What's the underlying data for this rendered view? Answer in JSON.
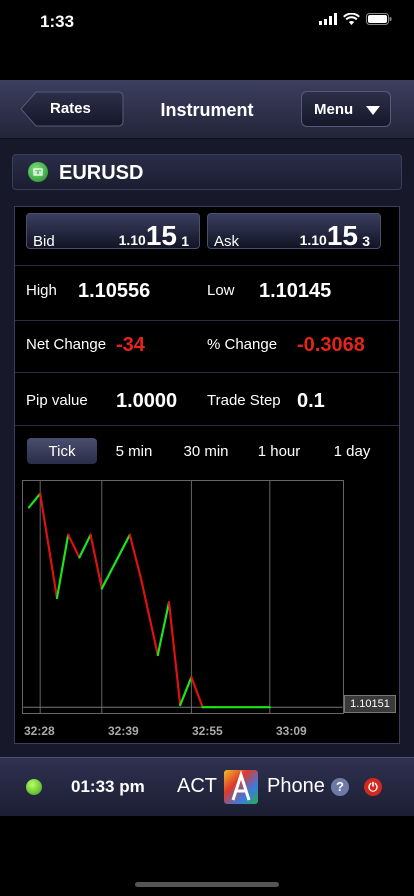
{
  "status_bar": {
    "time": "1:33"
  },
  "nav": {
    "back_label": "Rates",
    "title": "Instrument",
    "menu_label": "Menu"
  },
  "instrument": {
    "symbol": "EURUSD"
  },
  "quote": {
    "bid": {
      "label": "Bid",
      "prefix": "1.10",
      "big": "15",
      "suffix": "1"
    },
    "ask": {
      "label": "Ask",
      "prefix": "1.10",
      "big": "15",
      "suffix": "3"
    }
  },
  "stats": {
    "high_label": "High",
    "high": "1.10556",
    "low_label": "Low",
    "low": "1.10145",
    "net_change_label": "Net Change",
    "net_change": "-34",
    "pct_change_label": "% Change",
    "pct_change": "-0.3068",
    "pip_value_label": "Pip value",
    "pip_value": "1.0000",
    "trade_step_label": "Trade Step",
    "trade_step": "0.1"
  },
  "timeframes": [
    "Tick",
    "5 min",
    "30 min",
    "1 hour",
    "1 day"
  ],
  "timeframe_selected": "Tick",
  "chart": {
    "last_price": "1.10151",
    "x_labels": [
      "32:28",
      "32:39",
      "32:55",
      "33:09"
    ],
    "up_color": "#19e619",
    "down_color": "#e01010"
  },
  "chart_data": {
    "type": "line",
    "x": [
      "32:26",
      "32:28",
      "32:31",
      "32:33",
      "32:35",
      "32:37",
      "32:39",
      "32:44",
      "32:46",
      "32:49",
      "32:51",
      "32:53",
      "32:55",
      "32:57",
      "32:59",
      "33:09"
    ],
    "values": [
      1.1053,
      1.10556,
      1.10358,
      1.10478,
      1.10435,
      1.10478,
      1.10376,
      1.10478,
      1.10395,
      1.1025,
      1.1035,
      1.10155,
      1.10208,
      1.10151,
      1.10151,
      1.10151
    ],
    "x_tick_labels": [
      "32:28",
      "32:39",
      "32:55",
      "33:09"
    ],
    "ylim": [
      1.1014,
      1.1058
    ],
    "grid": true
  },
  "footer": {
    "clock": "01:33 pm",
    "brand_left": "ACT",
    "brand_right": "Phone",
    "status_color": "#3aa012"
  }
}
